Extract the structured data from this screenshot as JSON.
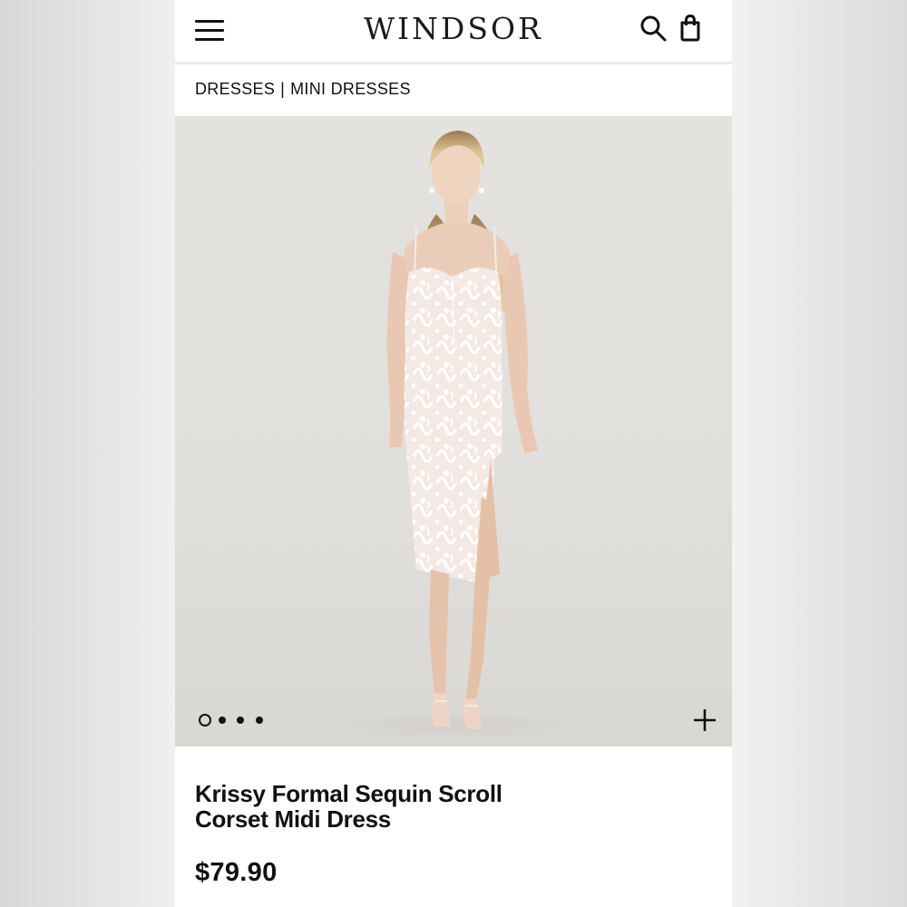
{
  "header": {
    "logo": "WINDSOR",
    "menu_icon": "hamburger-menu-icon",
    "search_icon": "search-icon",
    "bag_icon": "shopping-bag-icon"
  },
  "breadcrumb": {
    "items": [
      "DRESSES",
      "MINI DRESSES"
    ],
    "separator": "|"
  },
  "gallery": {
    "image_count": 4,
    "active_index": 0,
    "zoom_icon": "plus-icon"
  },
  "product": {
    "title_line1": "Krissy Formal Sequin Scroll",
    "title_line2": "Corset Midi Dress",
    "price": "$79.90"
  },
  "colors": {
    "text": "#111111",
    "background": "#ffffff",
    "photo_background": "#e2e0dd",
    "dress": "#f4ebe6",
    "lace": "#ffffff"
  }
}
